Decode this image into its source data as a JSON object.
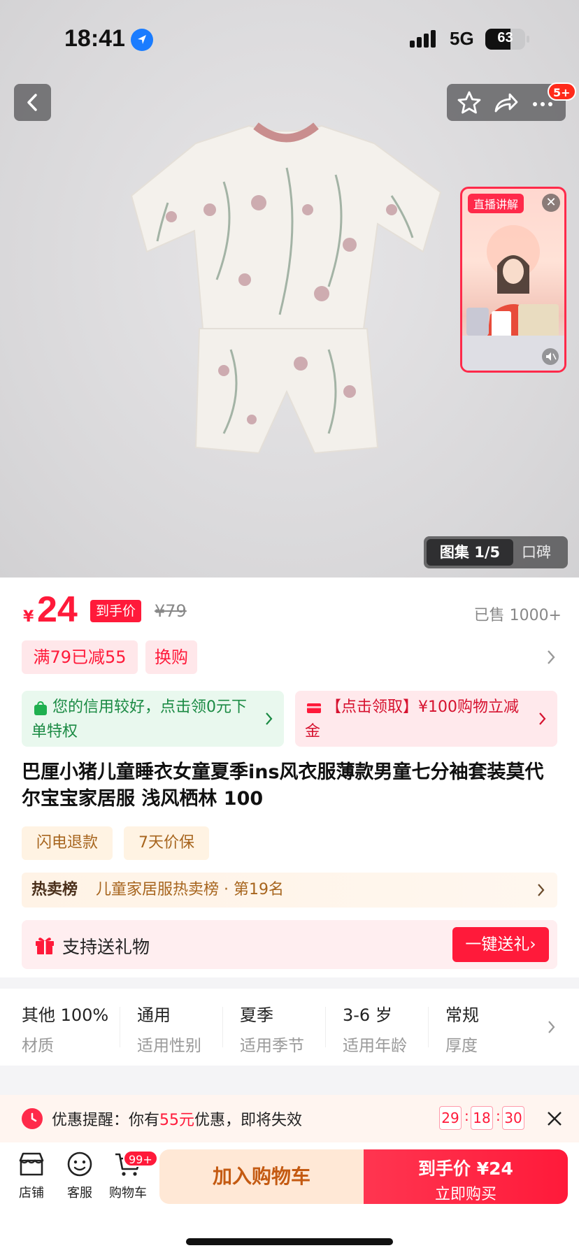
{
  "status_bar": {
    "time": "18:41",
    "network": "5G",
    "battery": "63",
    "battery_level": 0.63
  },
  "nav": {
    "cart_badge": "5+"
  },
  "live": {
    "tag": "直播讲解",
    "close": "✕"
  },
  "gallery": {
    "selected": "图集 1/5",
    "reviews": "口碑"
  },
  "price": {
    "currency": "¥",
    "value": "24",
    "tag": "到手价",
    "original": "¥79",
    "sold": "已售 1000+"
  },
  "promos": [
    {
      "label": "满79已减55"
    },
    {
      "label": "换购"
    }
  ],
  "credit": {
    "text": "您的信用较好，点击领0元下单特权"
  },
  "coupon": {
    "text": "【点击领取】¥100购物立减金"
  },
  "product": {
    "title": "巴厘小猪儿童睡衣女童夏季ins风衣服薄款男童七分袖套装莫代尔宝宝家居服 浅风栖林 100"
  },
  "services": [
    {
      "label": "闪电退款"
    },
    {
      "label": "7天价保"
    }
  ],
  "ranking": {
    "prefix": "热卖榜",
    "text": "儿童家居服热卖榜 · 第19名"
  },
  "gift": {
    "text": "支持送礼物",
    "button": "一键送礼›"
  },
  "specs": [
    {
      "value": "其他 100%",
      "key": "材质"
    },
    {
      "value": "通用",
      "key": "适用性别"
    },
    {
      "value": "夏季",
      "key": "适用季节"
    },
    {
      "value": "3-6 岁",
      "key": "适用年龄"
    },
    {
      "value": "常规",
      "key": "厚度"
    }
  ],
  "reminder": {
    "prefix": "优惠提醒：你有",
    "amount": "55元",
    "suffix": "优惠，即将失效",
    "countdown": [
      "29",
      "18",
      "30"
    ]
  },
  "bottom": {
    "store": "店铺",
    "service": "客服",
    "cart": "购物车",
    "cart_badge": "99+",
    "add_cart": "加入购物车",
    "buy_line1": "到手价 ¥24",
    "buy_line2": "立即购买"
  },
  "colors": {
    "accent": "#ff1a3a",
    "credit_green": "#1a8a43",
    "orange": "#c45a12"
  }
}
